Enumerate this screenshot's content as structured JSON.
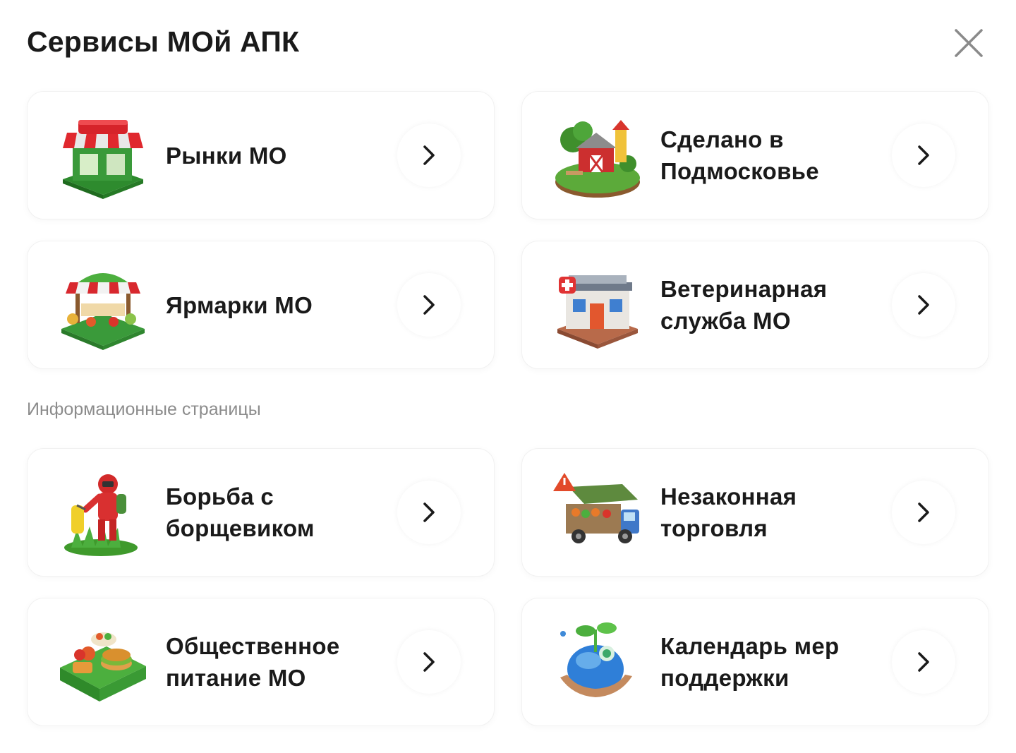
{
  "header": {
    "title": "Сервисы МОй АПК",
    "close_icon": "close-icon"
  },
  "services": [
    {
      "label": "Рынки МО",
      "icon": "market-stall-icon"
    },
    {
      "label": "Сделано в\nПодмосковье",
      "icon": "farm-barn-icon"
    },
    {
      "label": "Ярмарки МО",
      "icon": "fair-stall-icon"
    },
    {
      "label": "Ветеринарная\nслужба МО",
      "icon": "vet-clinic-icon"
    }
  ],
  "info_section": {
    "label": "Информационные страницы",
    "items": [
      {
        "label": "Борьба с\nборщевиком",
        "icon": "sprayer-worker-icon"
      },
      {
        "label": "Незаконная\nторговля",
        "icon": "illegal-truck-icon"
      },
      {
        "label": "Общественное\nпитание МО",
        "icon": "food-tray-icon"
      },
      {
        "label": "Календарь мер\nподдержки",
        "icon": "support-hands-icon"
      }
    ]
  },
  "colors": {
    "text": "#1a1a1a",
    "muted": "#8c8c8c",
    "card_border": "#f1f1f1",
    "close_icon": "#8a8a8a"
  }
}
